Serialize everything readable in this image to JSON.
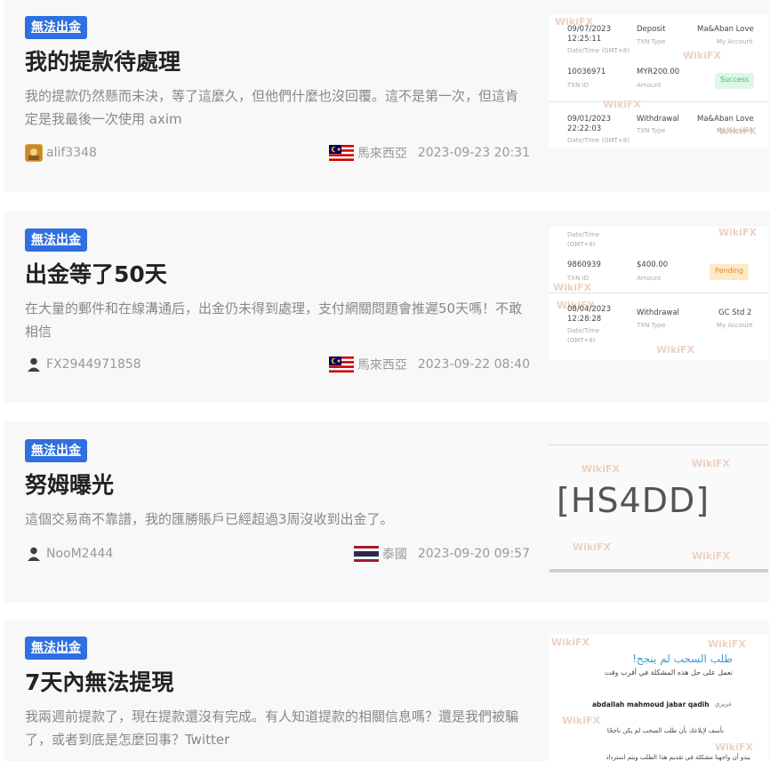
{
  "posts": [
    {
      "tag": "無法出金",
      "title": "我的提款待處理",
      "desc": "我的提款仍然懸而未決，等了這麼久，但他們什麼也沒回覆。這不是第一次，但這肯定是我最後一次使用 axim",
      "user": "alif3348",
      "country": "馬來西亞",
      "date": "2023-09-23 20:31",
      "thumb": {
        "watermark": "WikiFX",
        "row1": {
          "date": "09/07/2023",
          "time": "12:25:11",
          "date_label": "Date/Time (GMT+8)",
          "type": "Deposit",
          "type_label": "TXN Type",
          "account": "Ma&Aban Love",
          "account_label": "My Account",
          "id": "10036971",
          "id_label": "TXN ID",
          "amount": "MYR200.00",
          "amount_label": "Amount",
          "status": "Success"
        },
        "row2": {
          "date": "09/01/2023",
          "time": "22:22:03",
          "date_label": "Date/Time (GMT+8)",
          "type": "Withdrawal",
          "type_label": "TXN Type",
          "account": "Ma&Aban Love",
          "account_label": "My Account"
        }
      }
    },
    {
      "tag": "無法出金",
      "title": "出金等了50天",
      "desc": "在大量的郵件和在線溝通后，出金仍未得到處理，支付網關問題會推遲50天嗎！不敢相信",
      "user": "FX2944971858",
      "country": "馬來西亞",
      "date": "2023-09-22 08:40",
      "thumb": {
        "watermark": "WikiFX",
        "top_label": "Date/Time (GMT+8)",
        "id": "9860939",
        "id_label": "TXN ID",
        "amount": "$400.00",
        "amount_label": "Amount",
        "status": "Pending",
        "row2": {
          "date": "08/04/2023",
          "time": "12:28:28",
          "date_label": "Date/Time (GMT+8)",
          "type": "Withdrawal",
          "type_label": "TXN Type",
          "account": "GC Std 2",
          "account_label": "My Account"
        }
      }
    },
    {
      "tag": "無法出金",
      "title": "努姆曝光",
      "desc": "這個交易商不靠譜，我的匯勝賬戶已經超過3周沒收到出金了。",
      "user": "NooM2444",
      "country": "泰國",
      "date": "2023-09-20 09:57",
      "thumb": {
        "watermark": "WikiFX",
        "code": "[HS4DD]"
      }
    },
    {
      "tag": "無法出金",
      "title": "7天內無法提現",
      "desc": "我兩週前提款了，現在提款還沒有完成。有人知道提款的相關信息嗎？還是我們被騙了，或者到底是怎麼回事？Twitter",
      "thumb": {
        "watermark": "WikiFX",
        "ar_title": "طلب السحب لم ينجح!",
        "ar_line1": "نعمل على حل هذه المشكلة في أقرب وقت",
        "ar_name_label": "عزيزي",
        "ar_name": "abdallah mahmoud jabar qadih",
        "ar_line2": "نأسف لإبلاغك بأن طلب السحب لم يكن ناجحًا",
        "ar_line3": "يبدو أن واجهنا مشكلة في تقديم هذا الطلب ويتم استرداد"
      }
    }
  ],
  "colors": {
    "tag_bg": "#2f6fe0",
    "card_bg": "#f8f8f9",
    "success": "#2fbf71",
    "pending": "#f0a030"
  }
}
